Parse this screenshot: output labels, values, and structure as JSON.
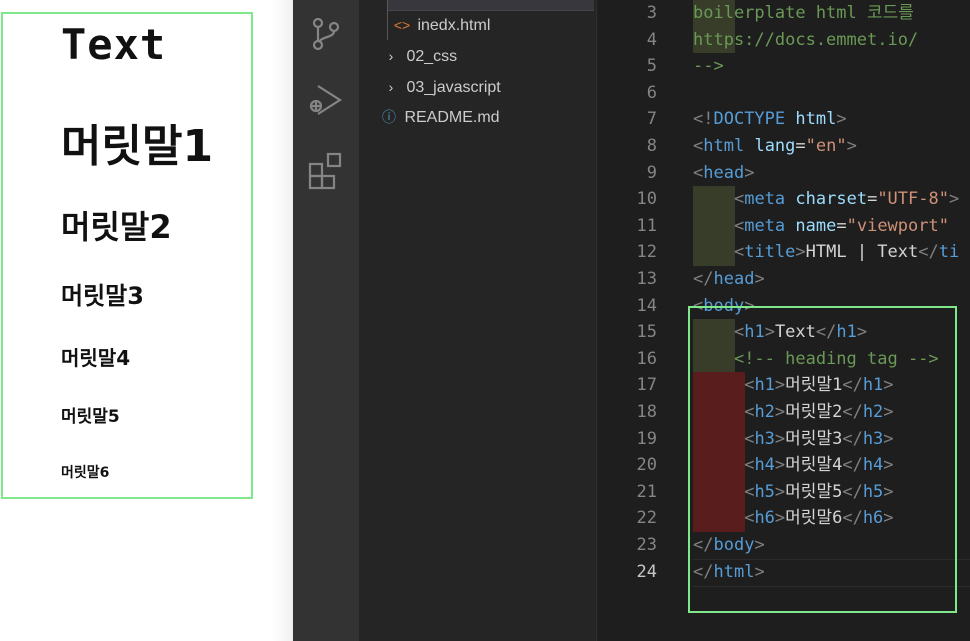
{
  "preview": {
    "text_heading": "Text",
    "h1": "머릿말1",
    "h2": "머릿말2",
    "h3": "머릿말3",
    "h4": "머릿말4",
    "h5": "머릿말5",
    "h6": "머릿말6"
  },
  "explorer": {
    "items": [
      {
        "label": "inedx.html",
        "icon": "html-file-icon"
      },
      {
        "label": "02_css",
        "icon": "chevron-right-icon"
      },
      {
        "label": "03_javascript",
        "icon": "chevron-right-icon"
      },
      {
        "label": "README.md",
        "icon": "info-icon"
      }
    ]
  },
  "activity_bar": {
    "icons": [
      "source-control-icon",
      "run-debug-icon",
      "extensions-icon"
    ]
  },
  "editor": {
    "active_line": "24",
    "lines": [
      {
        "n": "3",
        "parts": [
          [
            "cmt",
            "boilerplate html 코드를"
          ]
        ]
      },
      {
        "n": "4",
        "parts": [
          [
            "cmt",
            "https://docs.emmet.io/"
          ]
        ]
      },
      {
        "n": "5",
        "parts": [
          [
            "cmt",
            "-->"
          ]
        ]
      },
      {
        "n": "6",
        "parts": []
      },
      {
        "n": "7",
        "parts": [
          [
            "brk",
            "<!"
          ],
          [
            "tag",
            "DOCTYPE"
          ],
          [
            "txt",
            " "
          ],
          [
            "attr",
            "html"
          ],
          [
            "brk",
            ">"
          ]
        ]
      },
      {
        "n": "8",
        "parts": [
          [
            "brk",
            "<"
          ],
          [
            "tag",
            "html"
          ],
          [
            "txt",
            " "
          ],
          [
            "attr",
            "lang"
          ],
          [
            "txt",
            "="
          ],
          [
            "str",
            "\"en\""
          ],
          [
            "brk",
            ">"
          ]
        ]
      },
      {
        "n": "9",
        "parts": [
          [
            "brk",
            "<"
          ],
          [
            "tag",
            "head"
          ],
          [
            "brk",
            ">"
          ]
        ]
      },
      {
        "n": "10",
        "parts": [
          [
            "txt",
            "    "
          ],
          [
            "brk",
            "<"
          ],
          [
            "tag",
            "meta"
          ],
          [
            "txt",
            " "
          ],
          [
            "attr",
            "charset"
          ],
          [
            "txt",
            "="
          ],
          [
            "str",
            "\"UTF-8\""
          ],
          [
            "brk",
            ">"
          ]
        ]
      },
      {
        "n": "11",
        "parts": [
          [
            "txt",
            "    "
          ],
          [
            "brk",
            "<"
          ],
          [
            "tag",
            "meta"
          ],
          [
            "txt",
            " "
          ],
          [
            "attr",
            "name"
          ],
          [
            "txt",
            "="
          ],
          [
            "str",
            "\"viewport\""
          ]
        ]
      },
      {
        "n": "12",
        "parts": [
          [
            "txt",
            "    "
          ],
          [
            "brk",
            "<"
          ],
          [
            "tag",
            "title"
          ],
          [
            "brk",
            ">"
          ],
          [
            "txt",
            "HTML | Text"
          ],
          [
            "brk",
            "</"
          ],
          [
            "tag",
            "ti"
          ]
        ]
      },
      {
        "n": "13",
        "parts": [
          [
            "brk",
            "</"
          ],
          [
            "tag",
            "head"
          ],
          [
            "brk",
            ">"
          ]
        ]
      },
      {
        "n": "14",
        "parts": [
          [
            "brk",
            "<"
          ],
          [
            "tag",
            "body"
          ],
          [
            "brk",
            ">"
          ]
        ]
      },
      {
        "n": "15",
        "parts": [
          [
            "txt",
            "    "
          ],
          [
            "brk",
            "<"
          ],
          [
            "tag",
            "h1"
          ],
          [
            "brk",
            ">"
          ],
          [
            "txt",
            "Text"
          ],
          [
            "brk",
            "</"
          ],
          [
            "tag",
            "h1"
          ],
          [
            "brk",
            ">"
          ]
        ]
      },
      {
        "n": "16",
        "parts": [
          [
            "txt",
            "    "
          ],
          [
            "cmt",
            "<!-- heading tag -->"
          ]
        ]
      },
      {
        "n": "17",
        "parts": [
          [
            "txt",
            "     "
          ],
          [
            "brk",
            "<"
          ],
          [
            "tag",
            "h1"
          ],
          [
            "brk",
            ">"
          ],
          [
            "txt",
            "머릿말1"
          ],
          [
            "brk",
            "</"
          ],
          [
            "tag",
            "h1"
          ],
          [
            "brk",
            ">"
          ]
        ]
      },
      {
        "n": "18",
        "parts": [
          [
            "txt",
            "     "
          ],
          [
            "brk",
            "<"
          ],
          [
            "tag",
            "h2"
          ],
          [
            "brk",
            ">"
          ],
          [
            "txt",
            "머릿말2"
          ],
          [
            "brk",
            "</"
          ],
          [
            "tag",
            "h2"
          ],
          [
            "brk",
            ">"
          ]
        ]
      },
      {
        "n": "19",
        "parts": [
          [
            "txt",
            "     "
          ],
          [
            "brk",
            "<"
          ],
          [
            "tag",
            "h3"
          ],
          [
            "brk",
            ">"
          ],
          [
            "txt",
            "머릿말3"
          ],
          [
            "brk",
            "</"
          ],
          [
            "tag",
            "h3"
          ],
          [
            "brk",
            ">"
          ]
        ]
      },
      {
        "n": "20",
        "parts": [
          [
            "txt",
            "     "
          ],
          [
            "brk",
            "<"
          ],
          [
            "tag",
            "h4"
          ],
          [
            "brk",
            ">"
          ],
          [
            "txt",
            "머릿말4"
          ],
          [
            "brk",
            "</"
          ],
          [
            "tag",
            "h4"
          ],
          [
            "brk",
            ">"
          ]
        ]
      },
      {
        "n": "21",
        "parts": [
          [
            "txt",
            "     "
          ],
          [
            "brk",
            "<"
          ],
          [
            "tag",
            "h5"
          ],
          [
            "brk",
            ">"
          ],
          [
            "txt",
            "머릿말5"
          ],
          [
            "brk",
            "</"
          ],
          [
            "tag",
            "h5"
          ],
          [
            "brk",
            ">"
          ]
        ]
      },
      {
        "n": "22",
        "parts": [
          [
            "txt",
            "     "
          ],
          [
            "brk",
            "<"
          ],
          [
            "tag",
            "h6"
          ],
          [
            "brk",
            ">"
          ],
          [
            "txt",
            "머릿말6"
          ],
          [
            "brk",
            "</"
          ],
          [
            "tag",
            "h6"
          ],
          [
            "brk",
            ">"
          ]
        ]
      },
      {
        "n": "23",
        "parts": [
          [
            "brk",
            "</"
          ],
          [
            "tag",
            "body"
          ],
          [
            "brk",
            ">"
          ]
        ]
      },
      {
        "n": "24",
        "parts": [
          [
            "brk",
            "</"
          ],
          [
            "tag",
            "html"
          ],
          [
            "brk",
            ">"
          ]
        ]
      }
    ]
  },
  "colors": {
    "highlight_box": "#7ee88a",
    "indent_highlight": "#373d29",
    "error_highlight": "#5a1d1d"
  }
}
